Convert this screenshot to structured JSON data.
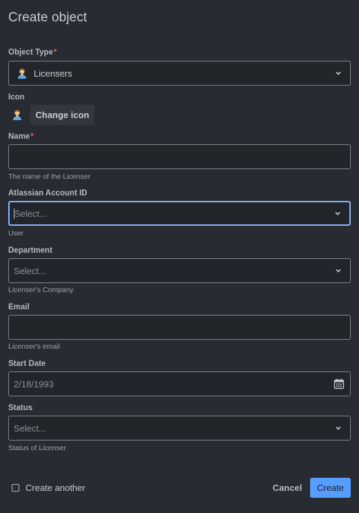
{
  "dialog": {
    "title": "Create object"
  },
  "object_type": {
    "label": "Object Type",
    "required_marker": "*",
    "value": "Licensers",
    "icon": "person-icon"
  },
  "icon_field": {
    "label": "Icon",
    "icon": "person-icon",
    "change_button": "Change icon"
  },
  "name_field": {
    "label": "Name",
    "required_marker": "*",
    "value": "",
    "helper": "The name of the Licenser"
  },
  "atlassian_account": {
    "label": "Atlassian Account ID",
    "placeholder": "Select...",
    "helper": "User"
  },
  "department": {
    "label": "Department",
    "placeholder": "Select...",
    "helper": "Licenser's Company"
  },
  "email": {
    "label": "Email",
    "value": "",
    "helper": "Licenser's email"
  },
  "start_date": {
    "label": "Start Date",
    "value": "2/18/1993"
  },
  "status": {
    "label": "Status",
    "placeholder": "Select...",
    "helper": "Status of Licenser"
  },
  "footer": {
    "create_another_label": "Create another",
    "create_another_checked": false,
    "cancel_label": "Cancel",
    "create_label": "Create"
  },
  "colors": {
    "background": "#282b31",
    "field_background": "#22252a",
    "field_border": "#7f8690",
    "focus_border": "#85b8ff",
    "primary_button": "#579dff",
    "required": "#f15c4f"
  }
}
